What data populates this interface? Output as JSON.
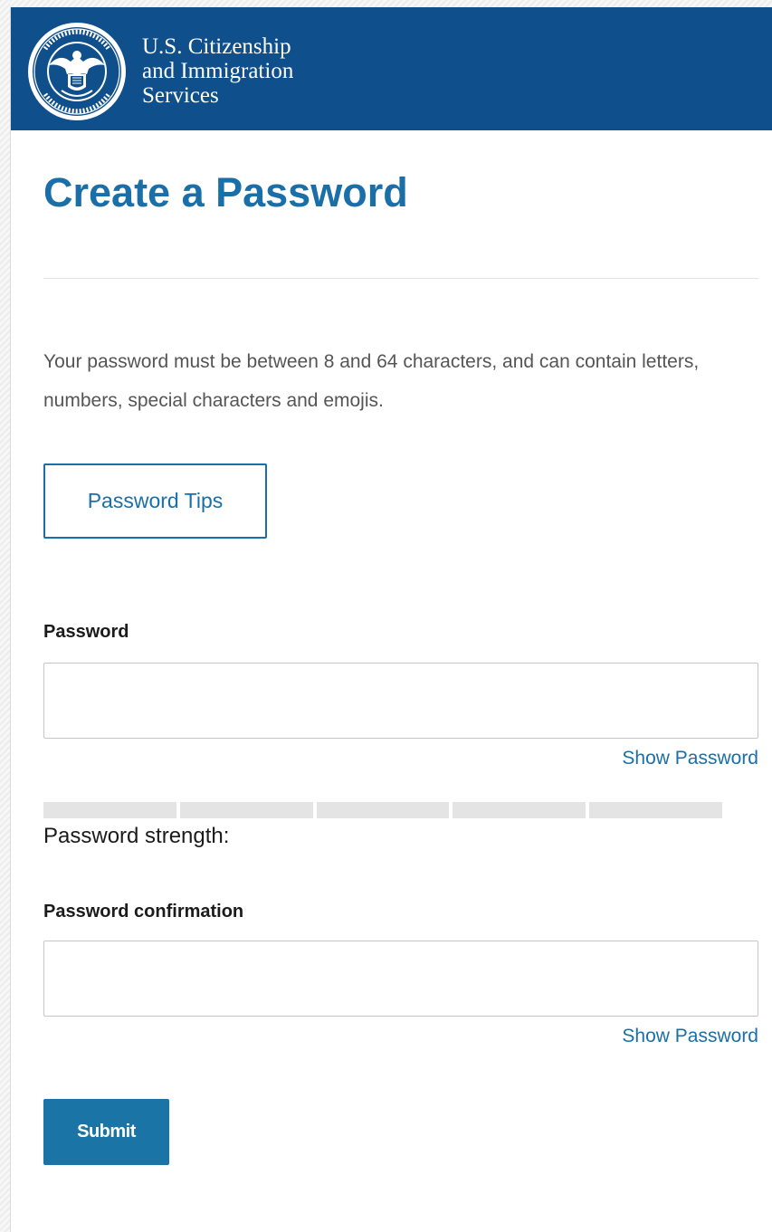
{
  "header": {
    "agency_line1": "U.S. Citizenship",
    "agency_line2": "and Immigration",
    "agency_line3": "Services",
    "seal_icon": "dhs-seal-icon",
    "background_color": "#0f4f8b"
  },
  "main": {
    "title": "Create a Password",
    "intro_text": "Your password must be between 8 and 64 characters, and can contain letters, numbers, special characters and emojis.",
    "tips_button_label": "Password Tips"
  },
  "form": {
    "password": {
      "label": "Password",
      "value": "",
      "placeholder": "",
      "show_label": "Show Password"
    },
    "strength": {
      "label": "Password strength:",
      "segments": 5,
      "filled_segments": 0
    },
    "confirmation": {
      "label": "Password confirmation",
      "value": "",
      "placeholder": "",
      "show_label": "Show Password"
    },
    "submit_label": "Submit"
  },
  "colors": {
    "accent": "#1a6fa8",
    "button": "#1a74a6",
    "text": "#1b1b1b",
    "muted_text": "#555555"
  }
}
